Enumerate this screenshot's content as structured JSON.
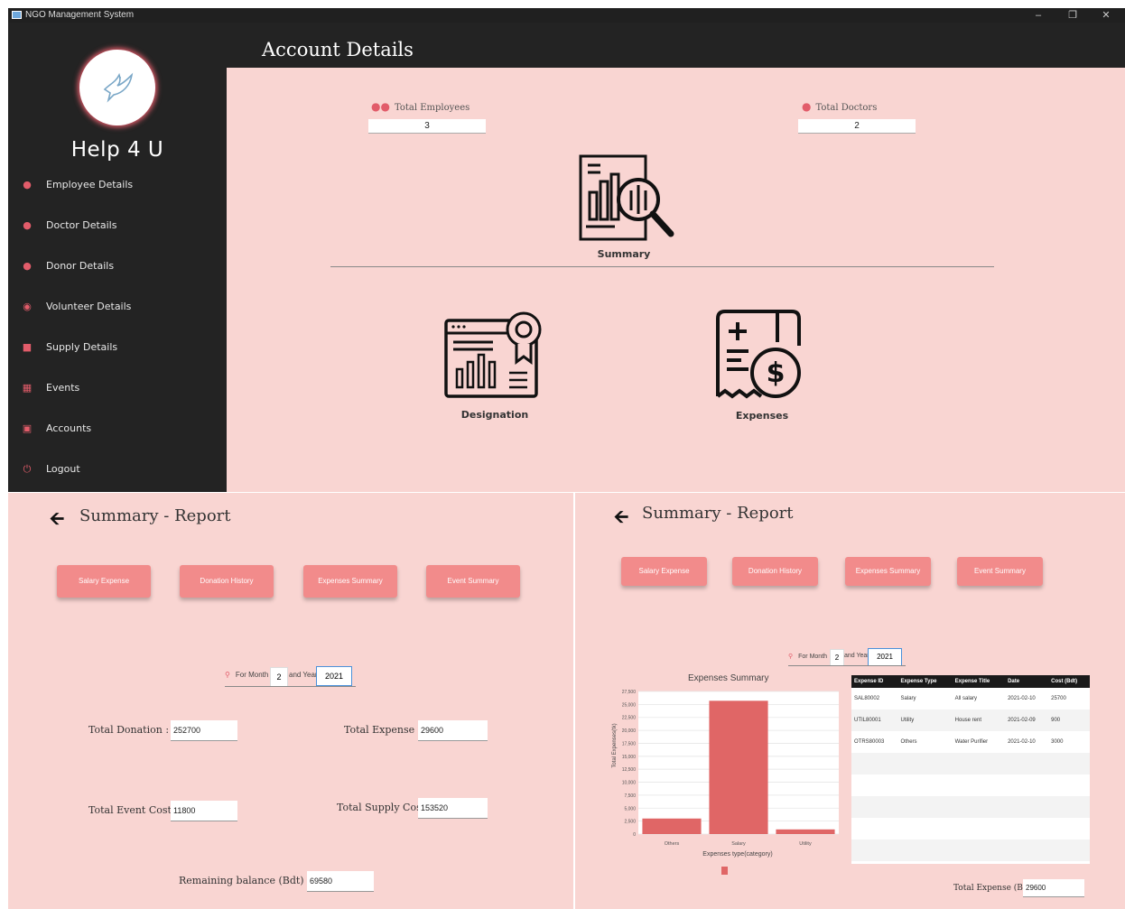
{
  "window": {
    "title": "NGO Management System"
  },
  "sidebar": {
    "brand": "Help 4 U",
    "items": [
      {
        "label": "Employee Details",
        "icon": "user-icon"
      },
      {
        "label": "Doctor Details",
        "icon": "doctor-icon"
      },
      {
        "label": "Donor Details",
        "icon": "user-icon"
      },
      {
        "label": "Volunteer Details",
        "icon": "eye-icon"
      },
      {
        "label": "Supply Details",
        "icon": "cart-icon"
      },
      {
        "label": "Events",
        "icon": "calendar-icon"
      },
      {
        "label": "Accounts",
        "icon": "book-icon"
      },
      {
        "label": "Logout",
        "icon": "power-icon"
      }
    ]
  },
  "header": {
    "title": "Account Details"
  },
  "stats": {
    "employees_label": "Total Employees",
    "employees_value": "3",
    "doctors_label": "Total Doctors",
    "doctors_value": "2"
  },
  "tiles": {
    "summary": "Summary",
    "designation": "Designation",
    "expenses": "Expenses"
  },
  "left_report": {
    "title": "Summary - Report",
    "buttons": [
      "Salary Expense",
      "Donation History",
      "Expenses Summary",
      "Event Summary"
    ],
    "filter": {
      "month_label": "For Month",
      "month": "2",
      "year_label": "and Year",
      "year": "2021"
    },
    "total_donation_label": "Total Donation :",
    "total_donation": "252700",
    "total_expense_label": "Total Expense :",
    "total_expense": "29600",
    "total_event_label": "Total Event Cost :",
    "total_event": "11800",
    "total_supply_label": "Total Supply Cost :",
    "total_supply": "153520",
    "remaining_label": "Remaining balance (Bdt) :",
    "remaining": "69580"
  },
  "right_report": {
    "title": "Summary - Report",
    "buttons": [
      "Salary Expense",
      "Donation History",
      "Expenses Summary",
      "Event Summary"
    ],
    "filter": {
      "month_label": "For Month",
      "month": "2",
      "year_label": "and Year",
      "year": "2021"
    },
    "table": {
      "headers": [
        "Expense ID",
        "Expense Type",
        "Expense Title",
        "Date",
        "Cost (Bdt)"
      ],
      "rows": [
        [
          "SAL80002",
          "Salary",
          "All salary",
          "2021-02-10",
          "25700"
        ],
        [
          "UTIL80001",
          "Utility",
          "House rent",
          "2021-02-09",
          "900"
        ],
        [
          "OTRS80003",
          "Others",
          "Water Purifier",
          "2021-02-10",
          "3000"
        ]
      ]
    },
    "total_expense_label": "Total Expense (Bdt) :",
    "total_expense": "29600"
  },
  "chart_data": {
    "type": "bar",
    "title": "Expenses Summary",
    "categories": [
      "Others",
      "Salary",
      "Utility"
    ],
    "values": [
      3000,
      25700,
      900
    ],
    "xlabel": "Expenses type(category)",
    "ylabel": "Total Expenses(tk)",
    "ylim": [
      0,
      27500
    ],
    "yticks": [
      0,
      2500,
      5000,
      7500,
      10000,
      12500,
      15000,
      17500,
      20000,
      22500,
      25000,
      27500
    ],
    "bar_color": "#e06666",
    "grid": true
  },
  "colors": {
    "accent": "#e25c6a",
    "button": "#f28b8b",
    "background": "#f9d5d2",
    "dark": "#232323"
  }
}
